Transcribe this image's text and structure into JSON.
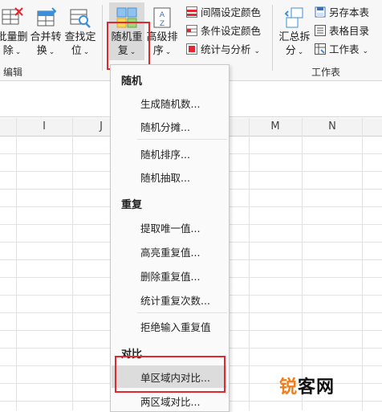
{
  "ribbon": {
    "buttons": {
      "batch_delete": {
        "line1": "批量删",
        "line2": "除"
      },
      "merge_convert": {
        "line1": "合并转",
        "line2": "换"
      },
      "find_locate": {
        "line1": "查找定",
        "line2": "位"
      },
      "random_repeat": {
        "line1": "随机重",
        "line2": "复"
      },
      "advanced_sort": {
        "line1": "高级排",
        "line2": "序"
      },
      "summary_split": {
        "line1": "汇总拆",
        "line2": "分"
      }
    },
    "small_items": {
      "interval_color": "间隔设定颜色",
      "condition_color": "条件设定颜色",
      "stats_analysis": "统计与分析",
      "save_sheet": "另存本表",
      "sheet_toc": "表格目录",
      "worksheet": "工作表"
    },
    "groups": {
      "edit": "编辑",
      "worksheet": "工作表"
    }
  },
  "columns": [
    "I",
    "J",
    "M",
    "N"
  ],
  "menu": {
    "sections": {
      "random": "随机",
      "repeat": "重复",
      "compare": "对比"
    },
    "items": [
      "生成随机数...",
      "随机分摊...",
      "随机排序...",
      "随机抽取...",
      "提取唯一值...",
      "高亮重复值...",
      "删除重复值...",
      "统计重复次数...",
      "拒绝输入重复值",
      "单区域内对比...",
      "两区域对比..."
    ]
  },
  "watermark": {
    "part1": "锐",
    "part2": "客网"
  },
  "colors": {
    "accent_red": "#e0282e",
    "watermark_orange": "#f07c1a"
  }
}
